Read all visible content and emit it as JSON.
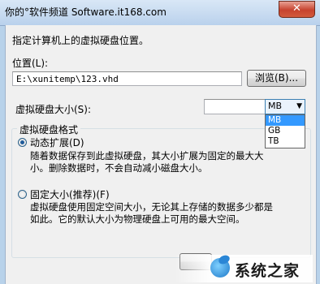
{
  "window": {
    "title": "你的°软件频道 Software.it168.com",
    "close_label": "✕"
  },
  "dialog": {
    "prompt": "指定计算机上的虚拟硬盘位置。",
    "location_label": "位置(L):",
    "location_value": "E:\\xunitemp\\123.vhd",
    "browse_label": "浏览(B)...",
    "size_label": "虚拟硬盘大小(S):",
    "size_value": "",
    "unit": {
      "selected": "MB",
      "options": [
        "MB",
        "GB",
        "TB"
      ]
    },
    "format_group_label": "虚拟硬盘格式",
    "dynamic": {
      "label": "动态扩展(D)",
      "checked": true,
      "description": "随着数据保存到此虚拟硬盘，其大小扩展为固定的最大大小。删除数据时，不会自动减小磁盘大小。"
    },
    "fixed": {
      "label": "固定大小(推荐)(F)",
      "checked": false,
      "description": "虚拟硬盘使用固定空间大小，无论其上存储的数据多少都是如此。它的默认大小为物理硬盘上可用的最大空间。"
    }
  },
  "watermark": {
    "text": "系统之家"
  },
  "colors": {
    "selection": "#3399ff",
    "close_button": "#c7432e",
    "window_frame": "#b9d1ec"
  }
}
